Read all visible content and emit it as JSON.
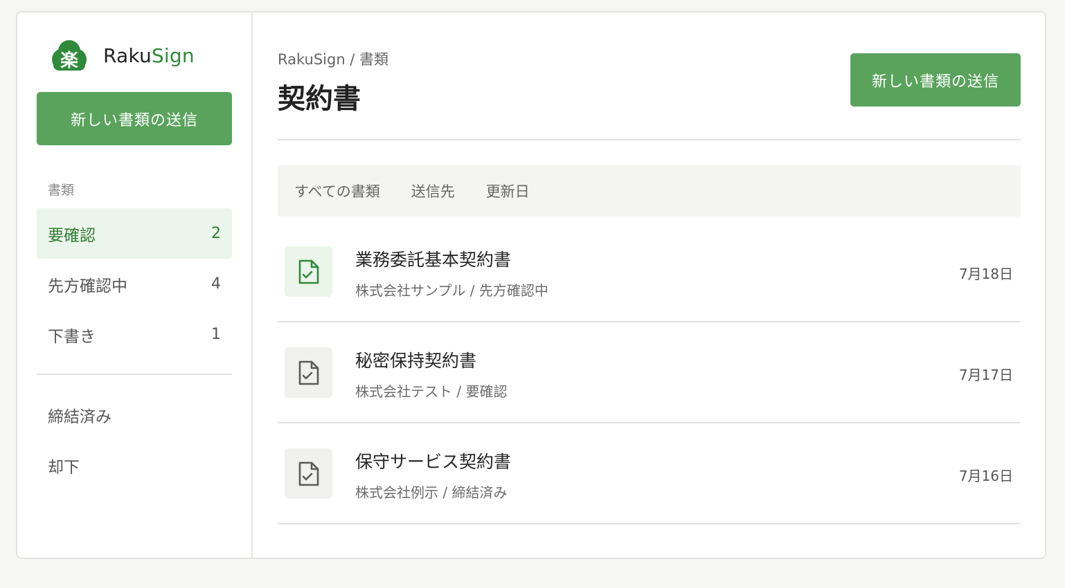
{
  "brand": {
    "name_part1": "Raku",
    "name_part2": "Sign",
    "logo_char": "楽",
    "accent_color": "#2f8a3a"
  },
  "sidebar": {
    "new_button_label": "新しい書類の送信",
    "section_label": "書類",
    "items": [
      {
        "label": "要確認",
        "count": "2",
        "active": true
      },
      {
        "label": "先方確認中",
        "count": "4"
      },
      {
        "label": "下書き",
        "count": "1"
      }
    ],
    "items2": [
      {
        "label": "締結済み"
      },
      {
        "label": "却下"
      }
    ]
  },
  "header": {
    "breadcrumb": "RakuSign / 書類",
    "title": "契約書",
    "new_button_label": "新しい書類の送信"
  },
  "tabs": [
    {
      "label": "すべての書類"
    },
    {
      "label": "送信先"
    },
    {
      "label": "更新日"
    }
  ],
  "documents": [
    {
      "title": "業務委託基本契約書",
      "meta": "株式会社サンプル / 先方確認中",
      "date": "7月18日",
      "icon": "document-check-icon",
      "highlight": true
    },
    {
      "title": "秘密保持契約書",
      "meta": "株式会社テスト / 要確認",
      "date": "7月17日",
      "icon": "document-check-icon"
    },
    {
      "title": "保守サービス契約書",
      "meta": "株式会社例示 / 締結済み",
      "date": "7月16日",
      "icon": "document-check-icon"
    }
  ],
  "colors": {
    "primary_button": "#5aa35c",
    "active_nav_bg": "#ecf5ec",
    "active_nav_text": "#2f7d32"
  }
}
